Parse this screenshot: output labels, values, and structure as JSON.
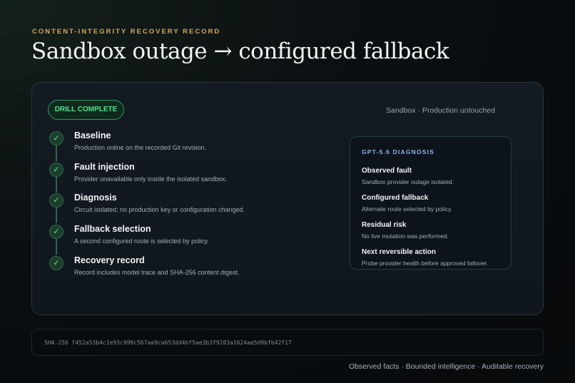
{
  "header": {
    "eyebrow": "CONTENT-INTEGRITY RECOVERY RECORD",
    "title": "Sandbox outage → configured fallback"
  },
  "card": {
    "badge": "DRILL COMPLETE",
    "environment": "Sandbox · Production untouched",
    "steps": [
      {
        "title": "Baseline",
        "desc": "Production online on the recorded Git revision.",
        "status": "✓"
      },
      {
        "title": "Fault injection",
        "desc": "Provider unavailable only inside the isolated sandbox.",
        "status": "✓"
      },
      {
        "title": "Diagnosis",
        "desc": "Circuit isolated; no production key or configuration changed.",
        "status": "✓"
      },
      {
        "title": "Fallback selection",
        "desc": "A second configured route is selected by policy.",
        "status": "✓"
      },
      {
        "title": "Recovery record",
        "desc": "Record includes model trace and SHA-256 content digest.",
        "status": "✓"
      }
    ],
    "diagnosis": {
      "heading": "GPT-5.6 DIAGNOSIS",
      "items": [
        {
          "title": "Observed fault",
          "desc": "Sandbox provider outage isolated."
        },
        {
          "title": "Configured fallback",
          "desc": "Alternate route selected by policy."
        },
        {
          "title": "Residual risk",
          "desc": "No live mutation was performed."
        },
        {
          "title": "Next reversible action",
          "desc": "Probe provider health before approved failover."
        }
      ]
    }
  },
  "hash": {
    "text": "SHA-256 f452a53b4c1e93c999c567aa9ca653dd4bf5ae3b3f9283a1624ae5d9bfb42f17"
  },
  "footer": {
    "text": "Observed facts · Bounded intelligence · Auditable recovery"
  },
  "colors": {
    "accent_gold": "#d2a864",
    "success_green": "#4fe08a",
    "diagnosis_blue": "#8fb3ee"
  }
}
